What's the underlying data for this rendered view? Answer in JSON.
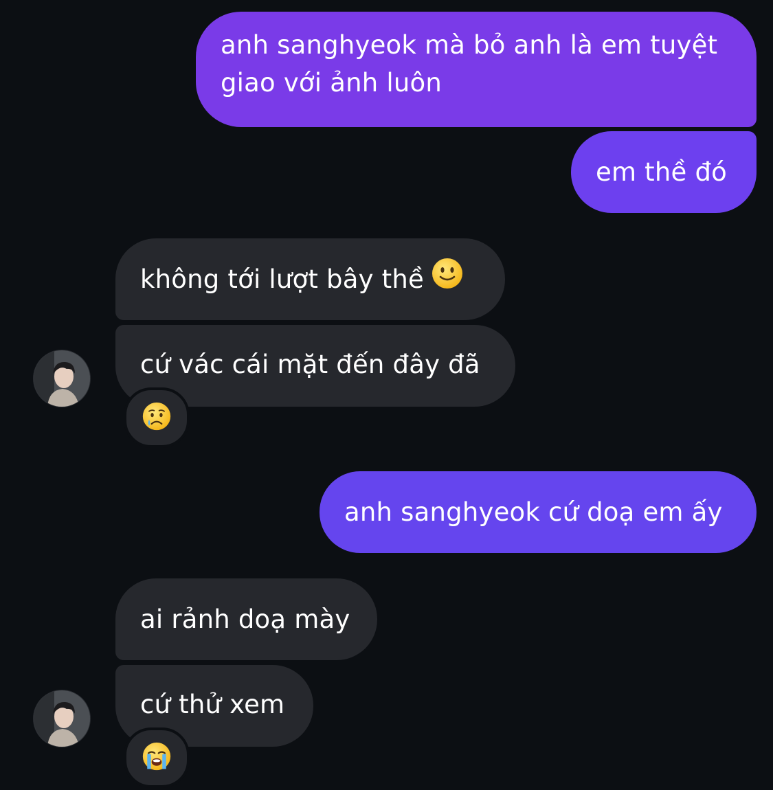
{
  "conversation": {
    "messages": [
      {
        "id": "m1",
        "direction": "outgoing",
        "text": "anh sanghyeok mà bỏ anh là em tuyệt giao với ảnh luôn"
      },
      {
        "id": "m2",
        "direction": "outgoing",
        "text": "em thề đó"
      },
      {
        "id": "m3",
        "direction": "incoming",
        "text": "không tới lượt bây thề",
        "inline_emoji": "slightly-smiling-face-icon"
      },
      {
        "id": "m4",
        "direction": "incoming",
        "text": "cứ vác cái mặt đến đây đã",
        "reaction": "crying-face-icon"
      },
      {
        "id": "m5",
        "direction": "outgoing",
        "text": "anh sanghyeok cứ doạ em ấy"
      },
      {
        "id": "m6",
        "direction": "incoming",
        "text": "ai rảnh doạ mày"
      },
      {
        "id": "m7",
        "direction": "incoming",
        "text": "cứ thử xem",
        "reaction": "loudly-crying-face-icon"
      }
    ]
  },
  "colors": {
    "background": "#0c0f13",
    "outgoing_bubble": "#6a45f0",
    "incoming_bubble": "#26282d",
    "text": "#ffffff"
  }
}
